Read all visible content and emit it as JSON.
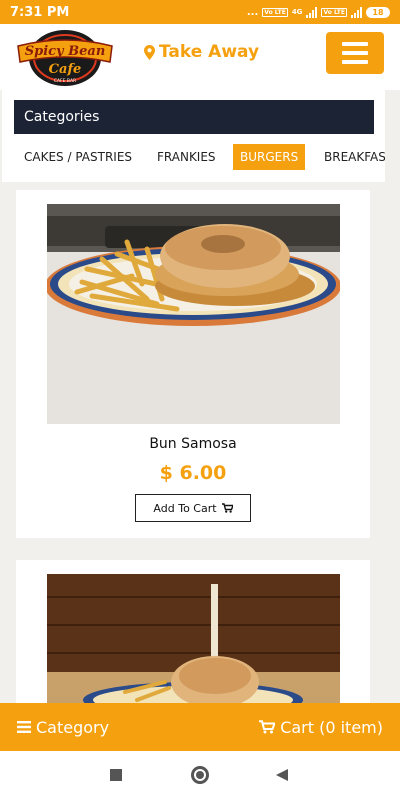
{
  "status_bar": {
    "time": "7:31 PM",
    "dots": "...",
    "network_badge_1": "Vo LTE",
    "network_type": "4G",
    "network_badge_2": "Vo LTE",
    "battery": "18"
  },
  "header": {
    "logo_text_line1": "Spicy Bean",
    "logo_text_line2": "Cafe",
    "logo_ribbon": "CAFE BAR",
    "order_mode": "Take Away",
    "order_mode_icon": "map-marker-icon",
    "menu_icon": "hamburger-icon"
  },
  "categories": {
    "heading": "Categories",
    "tabs": [
      {
        "label": "CAKES / PASTRIES",
        "active": false
      },
      {
        "label": "FRANKIES",
        "active": false
      },
      {
        "label": "BURGERS",
        "active": true
      },
      {
        "label": "BREAKFAST",
        "active": false
      }
    ]
  },
  "products": [
    {
      "name": "Bun Samosa",
      "price": "$ 6.00",
      "button_label": "Add To Cart",
      "button_icon": "cart-icon"
    }
  ],
  "bottom_bar": {
    "category_label": "Category",
    "category_icon": "list-icon",
    "cart_label": "Cart (0 item)",
    "cart_icon": "cart-icon"
  },
  "colors": {
    "accent": "#f5a00f",
    "heading_bg": "#1b2334",
    "page_bg": "#f1f0ec"
  }
}
